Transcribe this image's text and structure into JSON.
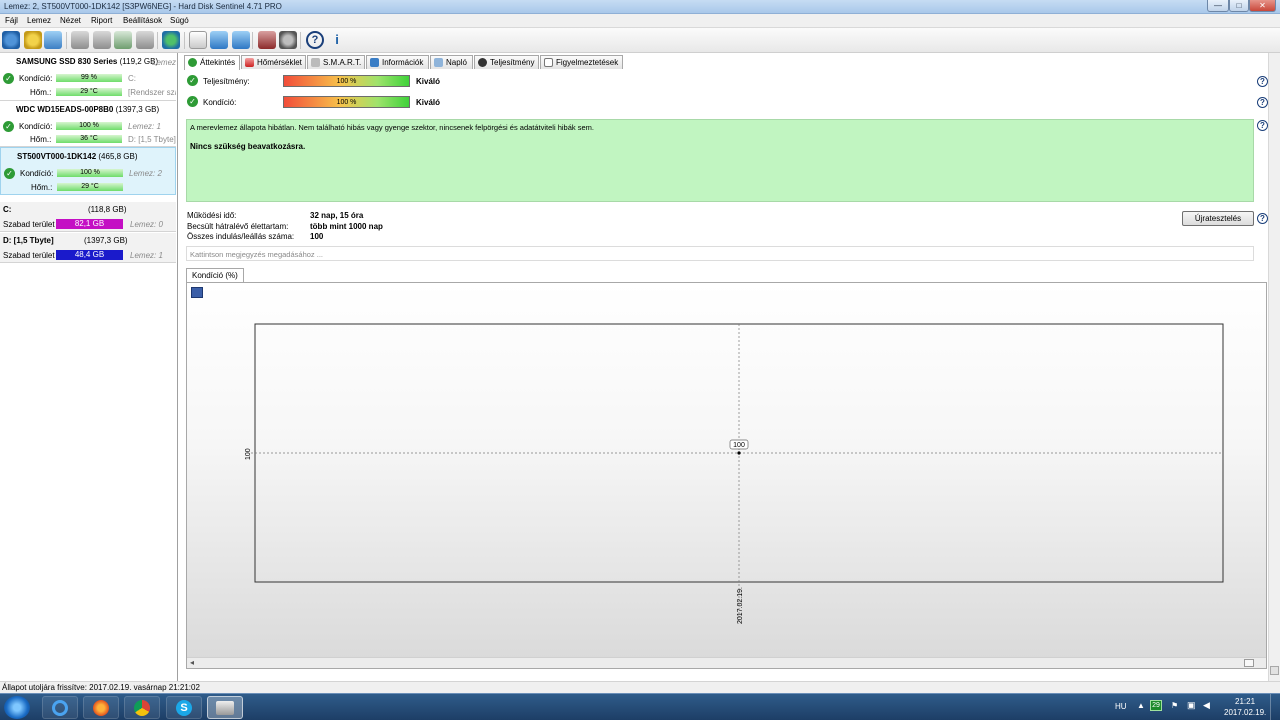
{
  "window": {
    "title": "Lemez: 2, ST500VT000-1DK142 [S3PW6NEG]  -  Hard Disk Sentinel 4.71 PRO",
    "controls": {
      "minimize": "—",
      "maximize": "□",
      "close": "✕"
    }
  },
  "menu": [
    "Fájl",
    "Lemez",
    "Nézet",
    "Riport",
    "Beállítások",
    "Súgó"
  ],
  "disks": [
    {
      "name": "SAMSUNG SSD 830 Series",
      "size": "(119,2 GB)",
      "condition_label": "Kondíció:",
      "condition": "99 %",
      "temp_label": "Hőm.:",
      "temp": "29 °C",
      "right1": "C:",
      "right2": "[Rendszer szá",
      "side": "Lemez:"
    },
    {
      "name": "WDC WD15EADS-00P8B0",
      "size": "(1397,3 GB)",
      "condition_label": "Kondíció:",
      "condition": "100 %",
      "temp_label": "Hőm.:",
      "temp": "36 °C",
      "right1": "Lemez: 1",
      "right2": "D: [1,5 Tbyte]"
    },
    {
      "name": "ST500VT000-1DK142",
      "size": "(465,8 GB)",
      "condition_label": "Kondíció:",
      "condition": "100 %",
      "temp_label": "Hőm.:",
      "temp": "29 °C",
      "right1": "Lemez: 2",
      "right2": ""
    }
  ],
  "volumes": [
    {
      "name": "C:",
      "size": "(118,8 GB)",
      "free_label": "Szabad terület",
      "free": "82,1 GB",
      "disk": "Lemez: 0",
      "color": "#c40fc4"
    },
    {
      "name": "D: [1,5 Tbyte]",
      "size": "(1397,3 GB)",
      "free_label": "Szabad terület",
      "free": "48,4 GB",
      "disk": "Lemez: 1",
      "color": "#1a1acb"
    }
  ],
  "tabs": [
    "Áttekintés",
    "Hőmérséklet",
    "S.M.A.R.T.",
    "Információk",
    "Napló",
    "Teljesítmény",
    "Figyelmeztetések"
  ],
  "overview": {
    "performance_label": "Teljesítmény:",
    "performance_value": "100 %",
    "performance_level": 1.0,
    "performance_rating": "Kiváló",
    "condition_label": "Kondíció:",
    "condition_value": "100 %",
    "condition_level": 1.0,
    "condition_rating": "Kiváló",
    "status_text": "A merevlemez állapota hibátlan. Nem található hibás vagy gyenge szektor, nincsenek felpörgési és adatátviteli hibák sem.",
    "status_action": "Nincs szükség beavatkozásra.",
    "uptime_label": "Működési idő:",
    "uptime_value": "32 nap, 15 óra",
    "lifetime_label": "Becsült hátralévő élettartam:",
    "lifetime_value": "több mint 1000 nap",
    "startstop_label": "Összes indulás/leállás száma:",
    "startstop_value": "100",
    "retest_button": "Újratesztelés",
    "note_placeholder": "Kattintson megjegyzés megadásához ..."
  },
  "chart_tab": "Kondíció  (%)",
  "chart_data": {
    "type": "line",
    "x": [
      "2017.02.19."
    ],
    "series": [
      {
        "values": [
          100
        ]
      }
    ],
    "xlabel": "",
    "ylabel": "",
    "y_tick_labels": [
      "100"
    ],
    "data_labels": [
      "100"
    ],
    "grid": true
  },
  "statusbar": "Állapot utoljára frissítve: 2017.02.19. vasárnap 21:21:02",
  "taskbar": {
    "lang": "HU",
    "time": "21:21",
    "date": "2017.02.19.",
    "tray_badge": "29"
  }
}
